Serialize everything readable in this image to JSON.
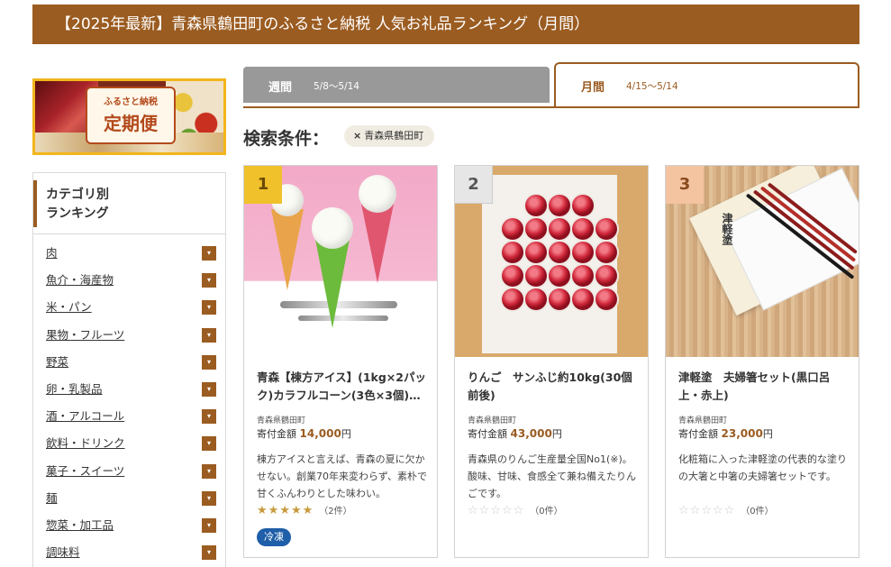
{
  "header": {
    "title": "【2025年最新】青森県鶴田町のふるさと納税 人気お礼品ランキング（月間）"
  },
  "banner": {
    "line1": "ふるさと納税",
    "line2": "定期便"
  },
  "sidebar": {
    "heading": "カテゴリ別\nランキング",
    "heading_line1": "カテゴリ別",
    "heading_line2": "ランキング",
    "arrow_icon": "▾",
    "items": [
      {
        "label": "肉"
      },
      {
        "label": "魚介・海産物"
      },
      {
        "label": "米・パン"
      },
      {
        "label": "果物・フルーツ"
      },
      {
        "label": "野菜"
      },
      {
        "label": "卵・乳製品"
      },
      {
        "label": "酒・アルコール"
      },
      {
        "label": "飲料・ドリンク"
      },
      {
        "label": "菓子・スイーツ"
      },
      {
        "label": "麺"
      },
      {
        "label": "惣菜・加工品"
      },
      {
        "label": "調味料"
      }
    ]
  },
  "tabs": [
    {
      "label": "週間",
      "period": "5/8〜5/14",
      "active": false
    },
    {
      "label": "月間",
      "period": "4/15〜5/14",
      "active": true
    }
  ],
  "search": {
    "label": "検索条件：",
    "chip_icon": "×",
    "chip": "青森県鶴田町"
  },
  "colors": {
    "accent": "#9b5c21",
    "tab_inactive": "#999999",
    "tag_blue": "#1f5ea8",
    "star": "#c89a3c"
  },
  "products": [
    {
      "rank": "1",
      "name": "青森【棟方アイス】(1kg×2パック)カラフルコーン(3色×3個)…",
      "location": "青森県鶴田町",
      "price_label": "寄付金額",
      "price": "14,000",
      "price_unit": "円",
      "description": "棟方アイスと言えば、青森の夏に欠かせない。創業70年来変わらず、素朴で甘くふんわりとした味わい。",
      "rating": 5,
      "review_count": "（2件）",
      "tag": "冷凍"
    },
    {
      "rank": "2",
      "name": "りんご　サンふじ約10kg(30個前後)",
      "location": "青森県鶴田町",
      "price_label": "寄付金額",
      "price": "43,000",
      "price_unit": "円",
      "description": "青森県のりんご生産量全国No1(※)。酸味、甘味、食感全て兼ね備えたりんごです。",
      "rating": 0,
      "review_count": "（0件）"
    },
    {
      "rank": "3",
      "name": "津軽塗　夫婦箸セット(黒口呂上・赤上)",
      "location": "青森県鶴田町",
      "price_label": "寄付金額",
      "price": "23,000",
      "price_unit": "円",
      "description": "化粧箱に入った津軽塗の代表的な塗りの大箸と中箸の夫婦箸セットです。",
      "rating": 0,
      "review_count": "（0件）",
      "image_label": "津軽塗"
    }
  ]
}
